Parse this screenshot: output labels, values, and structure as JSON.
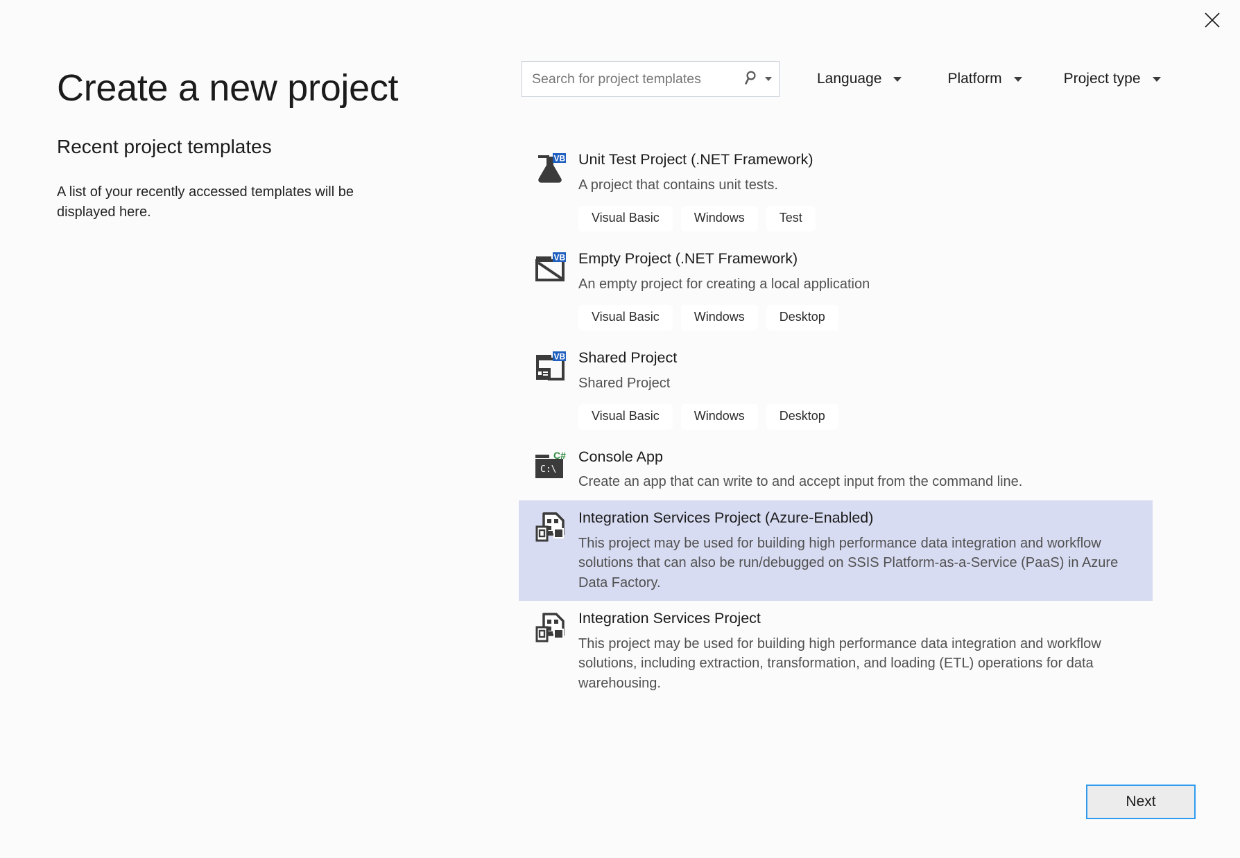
{
  "window": {
    "close_icon": "close-icon"
  },
  "header": {
    "title": "Create a new project",
    "search": {
      "placeholder": "Search for project templates",
      "value": "",
      "icon": "search-icon",
      "dropdown_icon": "chevron-down-icon"
    },
    "filters": [
      {
        "label": "Language",
        "icon": "chevron-down-icon"
      },
      {
        "label": "Platform",
        "icon": "chevron-down-icon"
      },
      {
        "label": "Project type",
        "icon": "chevron-down-icon"
      }
    ]
  },
  "recent": {
    "heading": "Recent project templates",
    "empty_message": "A list of your recently accessed templates will be displayed here."
  },
  "templates": [
    {
      "title": "Unit Test Project (.NET Framework)",
      "description": "A project that contains unit tests.",
      "icon": "flask-vb-icon",
      "badge": "VB",
      "tags": [
        "Visual Basic",
        "Windows",
        "Test"
      ],
      "selected": false
    },
    {
      "title": "Empty Project (.NET Framework)",
      "description": "An empty project for creating a local application",
      "icon": "empty-project-vb-icon",
      "badge": "VB",
      "tags": [
        "Visual Basic",
        "Windows",
        "Desktop"
      ],
      "selected": false
    },
    {
      "title": "Shared Project",
      "description": "Shared Project",
      "icon": "shared-project-vb-icon",
      "badge": "VB",
      "tags": [
        "Visual Basic",
        "Windows",
        "Desktop"
      ],
      "selected": false
    },
    {
      "title": "Console App",
      "description": "Create an app that can write to and accept input from the command line.",
      "icon": "console-csharp-icon",
      "badge": "C#",
      "tags": [],
      "selected": false
    },
    {
      "title": "Integration Services Project (Azure-Enabled)",
      "description": "This project may be used for building high performance data integration and workflow solutions that can also be run/debugged on SSIS Platform-as-a-Service (PaaS) in Azure Data Factory.",
      "icon": "integration-services-icon",
      "badge": "",
      "tags": [],
      "selected": true
    },
    {
      "title": "Integration Services Project",
      "description": "This project may be used for building high performance data integration and workflow solutions, including extraction, transformation, and loading (ETL) operations for data warehousing.",
      "icon": "integration-services-icon",
      "badge": "",
      "tags": [],
      "selected": false
    }
  ],
  "footer": {
    "next_label": "Next"
  },
  "colors": {
    "background": "#fbfbfb",
    "selection": "#d8dcf2",
    "accent": "#2e9bf0",
    "vb_badge": "#1f5fbf",
    "csharp_badge": "#2e8b3d",
    "icon_dark": "#3b3b3b"
  }
}
